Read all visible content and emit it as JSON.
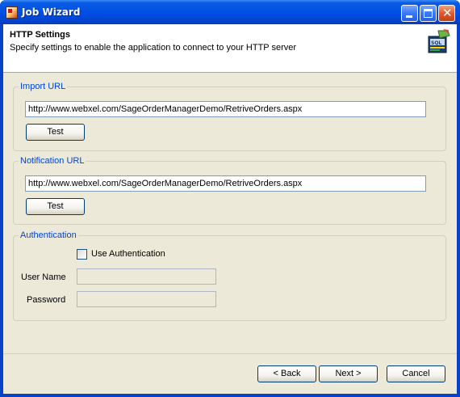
{
  "window": {
    "title": "Job Wizard",
    "icons": [
      "app-icon",
      "minimize-icon",
      "maximize-icon",
      "close-icon"
    ]
  },
  "header": {
    "title": "HTTP Settings",
    "subtitle": "Specify settings to enable the application to connect to your HTTP server",
    "logo_text": "SQL"
  },
  "import_group": {
    "legend": "Import URL",
    "url": "http://www.webxel.com/SageOrderManagerDemo/RetriveOrders.aspx",
    "test_label": "Test"
  },
  "notification_group": {
    "legend": "Notification URL",
    "url": "http://www.webxel.com/SageOrderManagerDemo/RetriveOrders.aspx",
    "test_label": "Test"
  },
  "auth_group": {
    "legend": "Authentication",
    "use_auth_label": "Use Authentication",
    "use_auth_checked": false,
    "username_label": "User Name",
    "username_value": "",
    "password_label": "Password",
    "password_value": ""
  },
  "footer": {
    "back_label": "< Back",
    "next_label": "Next >",
    "cancel_label": "Cancel"
  },
  "colors": {
    "title_bar": "#0050e6",
    "legend_text": "#0046d5",
    "dialog_bg": "#ece9d8"
  }
}
